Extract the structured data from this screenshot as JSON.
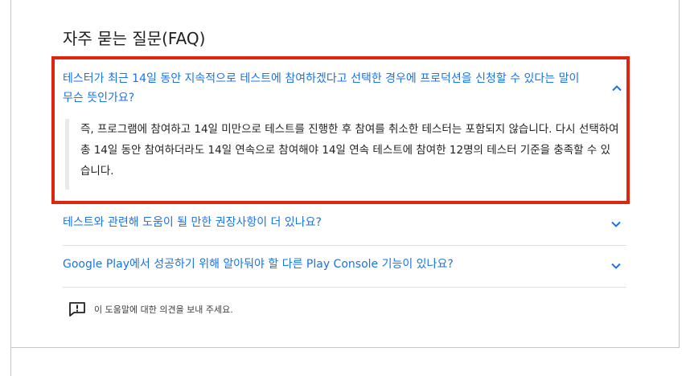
{
  "faq": {
    "title": "자주 묻는 질문(FAQ)",
    "items": [
      {
        "question": "테스터가 최근 14일 동안 지속적으로 테스트에 참여하겠다고 선택한 경우에 프로덕션을 신청할 수 있다는 말이 무슨 뜻인가요?",
        "answer": "즉, 프로그램에 참여하고 14일 미만으로 테스트를 진행한 후 참여를 취소한 테스터는 포함되지 않습니다. 다시 선택하여 총 14일 동안 참여하더라도 14일 연속으로 참여해야 14일 연속 테스트에 참여한 12명의 테스터 기준을 충족할 수 있습니다.",
        "expanded": true,
        "chevron_icon": "chevron-up-icon"
      },
      {
        "question": "테스트와 관련해 도움이 될 만한 권장사항이 더 있나요?",
        "expanded": false,
        "chevron_icon": "chevron-down-icon"
      },
      {
        "question": "Google Play에서 성공하기 위해 알아둬야 할 다른 Play Console 기능이 있나요?",
        "expanded": false,
        "chevron_icon": "chevron-down-icon"
      }
    ]
  },
  "feedback": {
    "label": "이 도움말에 대한 의견을 보내 주세요.",
    "icon": "feedback-icon"
  },
  "colors": {
    "link": "#1a73e8",
    "highlight_border": "#e0240e",
    "text": "#202124"
  }
}
